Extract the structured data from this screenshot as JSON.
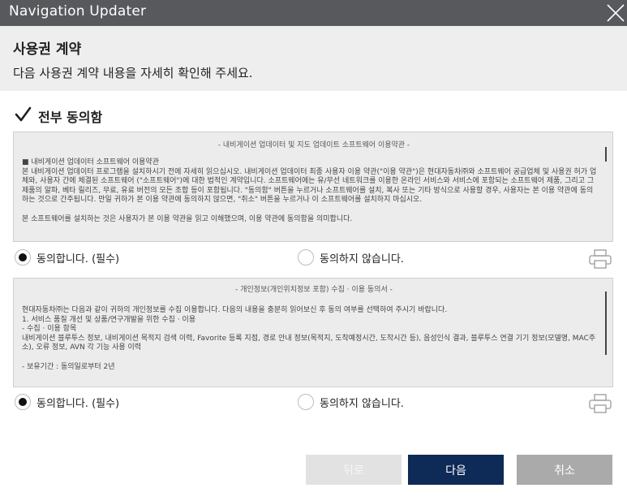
{
  "window": {
    "title": "Navigation Updater"
  },
  "header": {
    "title": "사용권 계약",
    "subtitle": "다음 사용권 계약 내용을 자세히 확인해 주세요."
  },
  "agree_all": {
    "label": "전부 동의함",
    "checked": true
  },
  "terms_1": {
    "heading": "- 내비게이션 업데이터 및 지도 업데이트 소프트웨어 이용약관 -",
    "body": "■ 내비게이션 업데이터 소프트웨어 이용약관\n본 내비게이션 업데이터 프로그램을 설치하시기 전에 자세히 읽으십시오. 내비게이션 업데이터 최종 사용자 이용 약관(\"이용 약관\")은 현대자동차㈜와 소프트웨어 공급업체 및 사용권 허가 업체와, 사용자 간에 체결된 소프트웨어 (\"소프트웨어\")에 대한 법적인 계약입니다. 소프트웨어에는 유/무선 네트워크를 이용한 온라인 서비스와 서비스에 포함되는 소프트웨어 제품, 그리고 그 제품의 알파, 베타 릴리즈, 무료, 유료 버전의 모든 조합 등이 포함됩니다. \"동의함\" 버튼을 누르거나 소프트웨어를 설치, 복사 또는 기타 방식으로 사용할 경우, 사용자는 본 이용 약관에 동의하는 것으로 간주됩니다. 만일 귀하가 본 이용 약관에 동의하지 않으면, \"취소\" 버튼을 누르거나 이 소프트웨어를 설치하지 마십시오.\n\n본 소프트웨어를 설치하는 것은 사용자가 본 이용 약관을 읽고 이해했으며, 이용 약관에 동의함을 의미합니다.",
    "options": {
      "agree": "동의합니다. (필수)",
      "disagree": "동의하지 않습니다."
    },
    "selected": "agree"
  },
  "terms_2": {
    "heading": "- 개인정보(개인위치정보 포함) 수집 · 이용 동의서 -",
    "body": "현대자동차㈜는 다음과 같이 귀하의 개인정보를 수집 이용합니다. 다음의 내용을 충분히 읽어보신 후 동의 여부를 선택하여 주시기 바랍니다.\n1. 서비스 품질 개선 및 상품/연구개발을 위한 수집 · 이용\n- 수집 · 이용 항목\n내비게이션 블루투스 정보, 내비게이션 목적지 검색 이력, Favorite 등록 지점, 경로 안내 정보(목적지, 도착예정시간, 도착시간 등), 음성인식 결과, 블루투스 연결 기기 정보(모델명, MAC주소), 오류 정보, AVN 각 기능 사용 이력\n\n- 보유기간 : 동의일로부터 2년",
    "options": {
      "agree": "동의합니다. (필수)",
      "disagree": "동의하지 않습니다."
    },
    "selected": "agree"
  },
  "buttons": {
    "back": "뒤로",
    "next": "다음",
    "cancel": "취소"
  },
  "colors": {
    "titlebar": "#58595c",
    "header_bg": "#eeeeee",
    "terms_bg": "#ececec",
    "next_button": "#0e2a57",
    "cancel_button": "#aaaaaa",
    "back_button_disabled": "#e2e2e2"
  },
  "icons": {
    "close": "close-icon",
    "check": "checkmark-icon",
    "print": "printer-icon"
  }
}
